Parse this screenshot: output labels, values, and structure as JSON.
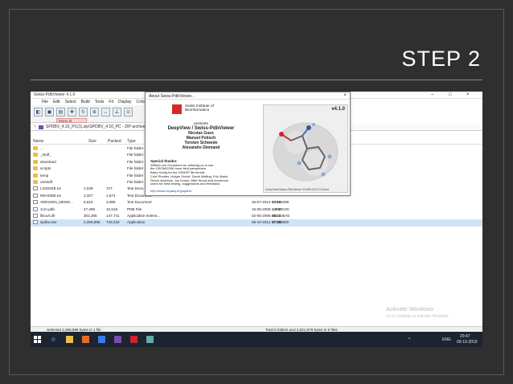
{
  "slide": {
    "title": "STEP 2"
  },
  "window": {
    "title": "Swiss-PdbViewer 4.1.0"
  },
  "menu": [
    "File",
    "Edit",
    "Select",
    "Build",
    "Tools",
    "Fit",
    "Display",
    "Color"
  ],
  "toolbar_tab": "Mono ld",
  "address": {
    "path": "SPDBV_4.10_PC(1).zip\\SPDBV_4.10_PC - ZIP archive"
  },
  "columns": {
    "name": "Name",
    "size": "Size",
    "packed": "Packed",
    "type": "Type"
  },
  "files": [
    {
      "name": "..",
      "size": "",
      "packed": "",
      "type": "File folder",
      "modified": "",
      "crc": "",
      "kind": "folder",
      "selected": false
    },
    {
      "name": "_stuff_",
      "size": "",
      "packed": "",
      "type": "File folder",
      "modified": "",
      "crc": "",
      "kind": "folder",
      "selected": false
    },
    {
      "name": "download",
      "size": "",
      "packed": "",
      "type": "File folder",
      "modified": "",
      "crc": "",
      "kind": "folder",
      "selected": false
    },
    {
      "name": "scripts",
      "size": "",
      "packed": "",
      "type": "File folder",
      "modified": "",
      "crc": "",
      "kind": "folder",
      "selected": false
    },
    {
      "name": "temp",
      "size": "",
      "packed": "",
      "type": "File folder",
      "modified": "",
      "crc": "",
      "kind": "folder",
      "selected": false
    },
    {
      "name": "usrstuff",
      "size": "",
      "packed": "",
      "type": "File folder",
      "modified": "",
      "crc": "",
      "kind": "folder",
      "selected": false
    },
    {
      "name": "LICENSE.txt",
      "size": "1,539",
      "packed": "727",
      "type": "Text Docu",
      "modified": "",
      "crc": "",
      "kind": "file",
      "selected": false
    },
    {
      "name": "README.txt",
      "size": "3,327",
      "packed": "1,674",
      "type": "Text Document",
      "modified": "",
      "crc": "",
      "kind": "file",
      "selected": false
    },
    {
      "name": "VERSION_NEWS...",
      "size": "8,615",
      "packed": "3,986",
      "type": "Text Document",
      "modified": "25-07-2012 17:18",
      "crc": "D2943299",
      "kind": "file",
      "selected": false
    },
    {
      "name": "1crn.pdb",
      "size": "47,396",
      "packed": "10,519",
      "type": "PDB File",
      "modified": "16-05-2008 13:04",
      "crc": "13F50C0C",
      "kind": "file",
      "selected": false
    },
    {
      "name": "libcurl.dll",
      "size": "303,205",
      "packed": "147,741",
      "type": "Application extens...",
      "modified": "02-05-2006 15:33",
      "crc": "BB1836A5",
      "kind": "file",
      "selected": false
    },
    {
      "name": "spdbv.exe",
      "size": "2,256,896",
      "packed": "749,222",
      "type": "Application",
      "modified": "06-10-2012 17:36",
      "crc": "8F40B560",
      "kind": "file",
      "selected": true
    }
  ],
  "status": {
    "left": "Selected 2,256,896 bytes in 1 file",
    "right": "Total 5 folders and 2,621,978 bytes in 6 files"
  },
  "watermark": {
    "line1": "Activate Windows",
    "line2": "Go to Settings to activate Windows."
  },
  "about": {
    "title": "About Swiss-PdbViewer...",
    "close": "×",
    "institute_line1": "Swiss Institute of",
    "institute_line2": "Bioinformatics",
    "presents": "presents",
    "product": "DeepView / Swiss-PdbViewer",
    "authors": [
      "Nicolas Guex",
      "Manuel Peitsch",
      "Torsten Schwede",
      "Alexandre Diemand"
    ],
    "special_header": "Special thanks:",
    "special_lines": [
      "Wilfred van Gunsteren for allowing us to use",
      "the GROMOS96 force field parameters",
      "Barry Honig for the GRASP file format",
      "Cole Rhodes, Holger Scholt, David Walling, Eric Martz,",
      "Simon Andrews, Jos Kraan, Mike Wood and numerous",
      "users for beta testing, suggestions and feedback."
    ],
    "link": "http://www.expasy.org/spdbv/",
    "version": "v4.1.0",
    "caption": "DeepView/Swiss-PdbViewer ©1995-2012 N.Guex"
  },
  "tray": {
    "lang": "ENG",
    "time": "20:47",
    "date": "09-10-2019"
  }
}
